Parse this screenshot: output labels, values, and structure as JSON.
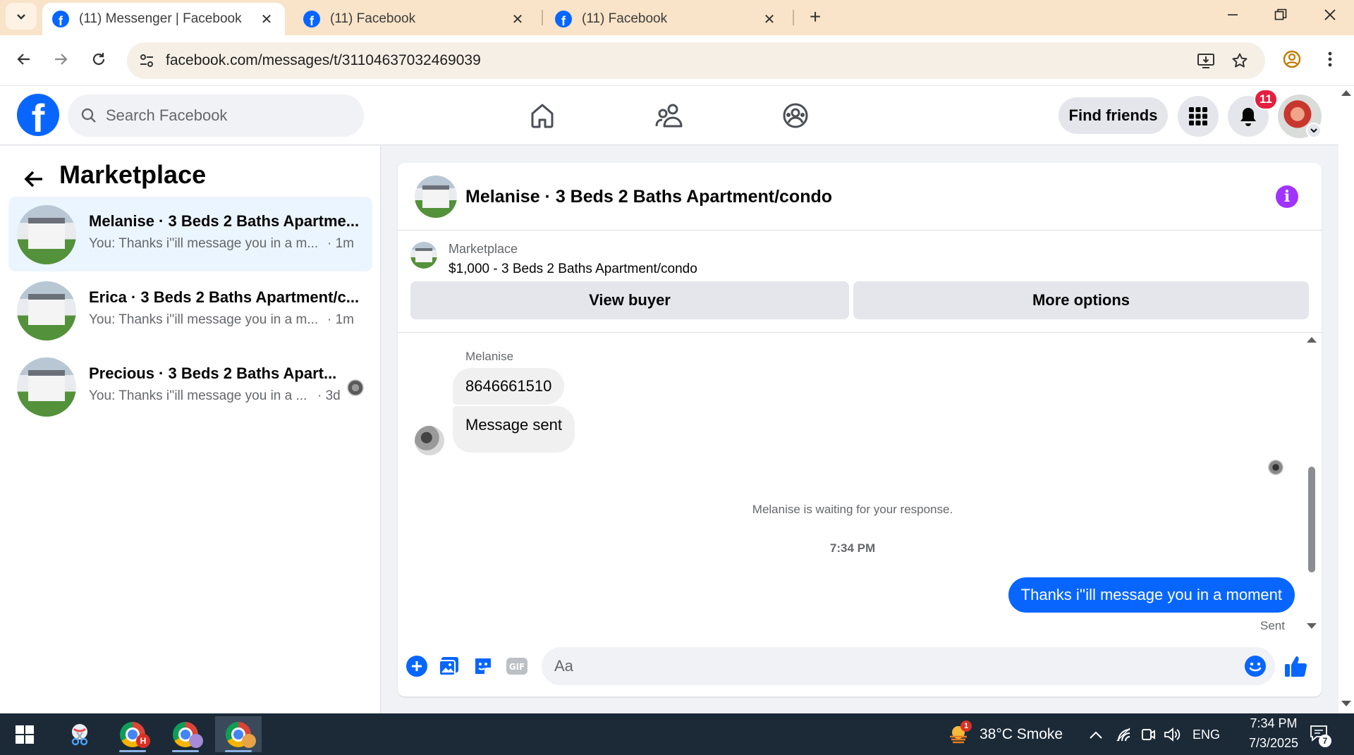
{
  "browser": {
    "tabs": [
      {
        "title": "(11) Messenger | Facebook",
        "active": true
      },
      {
        "title": "(11) Facebook",
        "active": false
      },
      {
        "title": "(11) Facebook",
        "active": false
      }
    ],
    "url": "facebook.com/messages/t/31104637032469039"
  },
  "fb_header": {
    "logo_letter": "f",
    "search_placeholder": "Search Facebook",
    "find_friends_label": "Find friends",
    "notification_count": "11"
  },
  "sidebar": {
    "title": "Marketplace",
    "conversations": [
      {
        "name": "Melanise · 3 Beds 2 Baths Apartme...",
        "preview": "You: Thanks i''ill message you in a m...",
        "time": "· 1m",
        "active": true
      },
      {
        "name": "Erica · 3 Beds 2 Baths Apartment/c...",
        "preview": "You: Thanks i''ill message you in a m...",
        "time": "· 1m",
        "active": false
      },
      {
        "name": "Precious · 3 Beds 2 Baths Apart...",
        "preview": "You: Thanks i''ill message you in a ...",
        "time": "· 3d",
        "active": false
      }
    ]
  },
  "chat": {
    "title": "Melanise · 3 Beds 2 Baths Apartment/condo",
    "listing": {
      "source": "Marketplace",
      "item": "$1,000 - 3 Beds 2 Baths Apartment/condo",
      "view_buyer_label": "View buyer",
      "more_options_label": "More options"
    },
    "messages": {
      "sender_name": "Melanise",
      "incoming": [
        "8646661510",
        "Message sent"
      ],
      "waiting_note": "Melanise is waiting for your response.",
      "timestamp": "7:34 PM",
      "outgoing": "Thanks i''ill message you in a moment",
      "sent_status": "Sent"
    },
    "composer": {
      "placeholder": "Aa"
    }
  },
  "taskbar": {
    "weather_alert": "1",
    "weather": "38°C  Smoke",
    "language": "ENG",
    "time": "7:34 PM",
    "date": "7/3/2025",
    "notification_count": "7",
    "chrome_profile_letter": "H"
  },
  "colors": {
    "facebook_blue": "#0866ff",
    "tab_strip": "#f9e4c9",
    "notification_red": "#e41e3f",
    "info_purple": "#a033ff",
    "taskbar": "#1c2a38"
  }
}
